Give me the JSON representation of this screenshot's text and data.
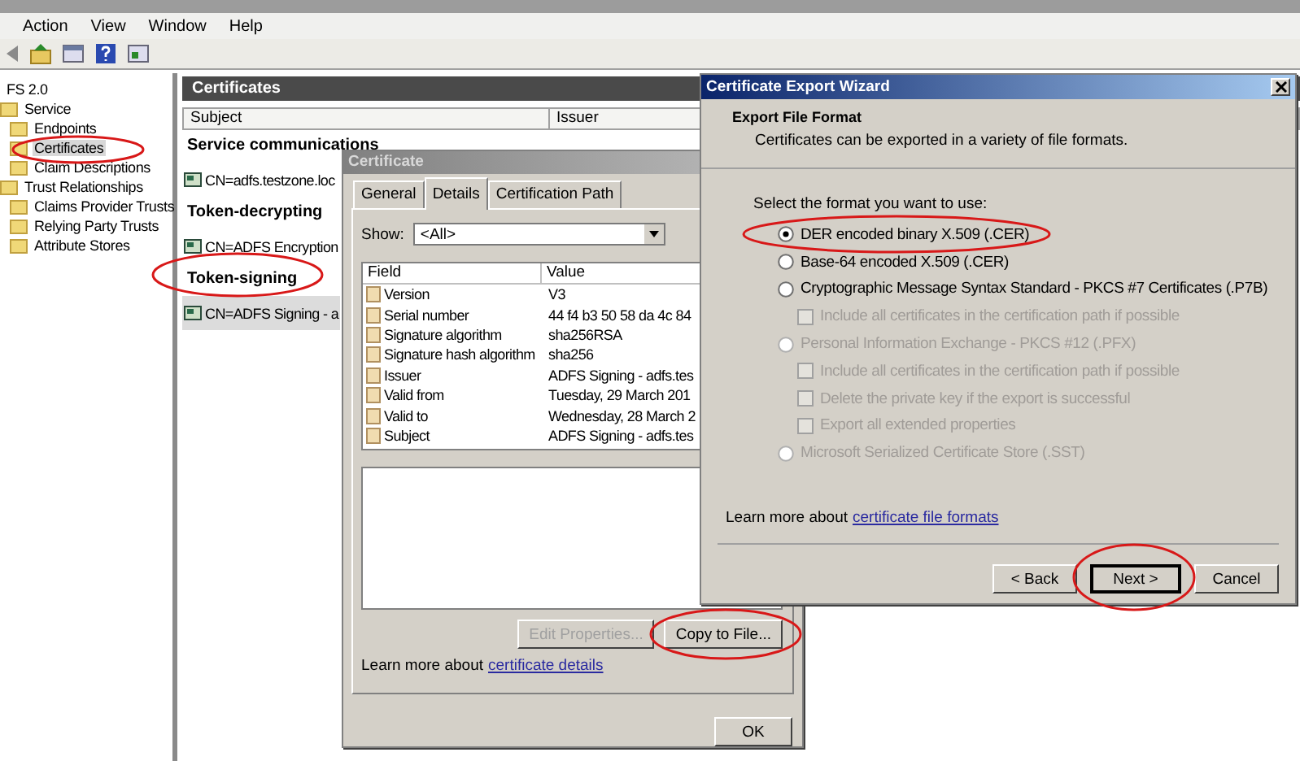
{
  "main_window": {
    "menu": [
      "Action",
      "View",
      "Window",
      "Help"
    ],
    "tree": {
      "root": "FS 2.0",
      "items": [
        {
          "label": "Service",
          "selected": false,
          "children": [
            {
              "label": "Endpoints",
              "selected": false
            },
            {
              "label": "Certificates",
              "selected": true
            },
            {
              "label": "Claim Descriptions",
              "selected": false
            }
          ]
        },
        {
          "label": "Trust Relationships",
          "selected": false,
          "children": [
            {
              "label": "Claims Provider Trusts",
              "selected": false
            },
            {
              "label": "Relying Party Trusts",
              "selected": false
            },
            {
              "label": "Attribute Stores",
              "selected": false
            }
          ]
        }
      ]
    },
    "certificates_pane": {
      "title": "Certificates",
      "columns": [
        "Subject",
        "Issuer"
      ],
      "groups": [
        {
          "title": "Service communications",
          "rows": [
            {
              "subject": "CN=adfs.testzone.loc",
              "selected": false
            }
          ]
        },
        {
          "title": "Token-decrypting",
          "rows": [
            {
              "subject": "CN=ADFS Encryption",
              "selected": false
            }
          ]
        },
        {
          "title": "Token-signing",
          "rows": [
            {
              "subject": "CN=ADFS Signing - a",
              "selected": true
            }
          ]
        }
      ]
    }
  },
  "certificate_dialog": {
    "title": "Certificate",
    "tabs": [
      {
        "label": "General",
        "selected": false
      },
      {
        "label": "Details",
        "selected": true
      },
      {
        "label": "Certification Path",
        "selected": false
      }
    ],
    "show_label": "Show:",
    "show_value": "<All>",
    "columns": [
      "Field",
      "Value"
    ],
    "fields": [
      {
        "field": "Version",
        "value": "V3"
      },
      {
        "field": "Serial number",
        "value": "44 f4 b3 50 58 da 4c 84"
      },
      {
        "field": "Signature algorithm",
        "value": "sha256RSA"
      },
      {
        "field": "Signature hash algorithm",
        "value": "sha256"
      },
      {
        "field": "Issuer",
        "value": "ADFS Signing - adfs.tes"
      },
      {
        "field": "Valid from",
        "value": "Tuesday, 29 March 201"
      },
      {
        "field": "Valid to",
        "value": "Wednesday, 28 March 2"
      },
      {
        "field": "Subject",
        "value": "ADFS Signing - adfs.tes"
      }
    ],
    "buttons": [
      {
        "label": "Edit Properties...",
        "disabled": true
      },
      {
        "label": "Copy to File...",
        "disabled": false
      }
    ],
    "learn_more": {
      "text": "Learn more about",
      "link": "certificate details"
    },
    "ok_button": "OK"
  },
  "export_wizard": {
    "title": "Certificate Export Wizard",
    "heading": "Export File Format",
    "subheading": "Certificates can be exported in a variety of file formats.",
    "prompt": "Select the format you want to use:",
    "options": [
      {
        "kind": "radio",
        "label": "DER encoded binary X.509 (.CER)",
        "selected": true,
        "disabled": false
      },
      {
        "kind": "radio",
        "label": "Base-64 encoded X.509 (.CER)",
        "selected": false,
        "disabled": false
      },
      {
        "kind": "radio",
        "label": "Cryptographic Message Syntax Standard - PKCS #7 Certificates (.P7B)",
        "selected": false,
        "disabled": false
      },
      {
        "kind": "checkbox",
        "label": "Include all certificates in the certification path if possible",
        "checked": false,
        "disabled": true
      },
      {
        "kind": "radio",
        "label": "Personal Information Exchange - PKCS #12 (.PFX)",
        "selected": false,
        "disabled": true
      },
      {
        "kind": "checkbox",
        "label": "Include all certificates in the certification path if possible",
        "checked": false,
        "disabled": true
      },
      {
        "kind": "checkbox",
        "label": "Delete the private key if the export is successful",
        "checked": false,
        "disabled": true
      },
      {
        "kind": "checkbox",
        "label": "Export all extended properties",
        "checked": false,
        "disabled": true
      },
      {
        "kind": "radio",
        "label": "Microsoft Serialized Certificate Store (.SST)",
        "selected": false,
        "disabled": true
      }
    ],
    "learn_more": {
      "text": "Learn more about",
      "link": "certificate file formats"
    },
    "buttons": [
      {
        "label": "< Back",
        "default": false
      },
      {
        "label": "Next >",
        "default": true
      },
      {
        "label": "Cancel",
        "default": false
      }
    ]
  }
}
